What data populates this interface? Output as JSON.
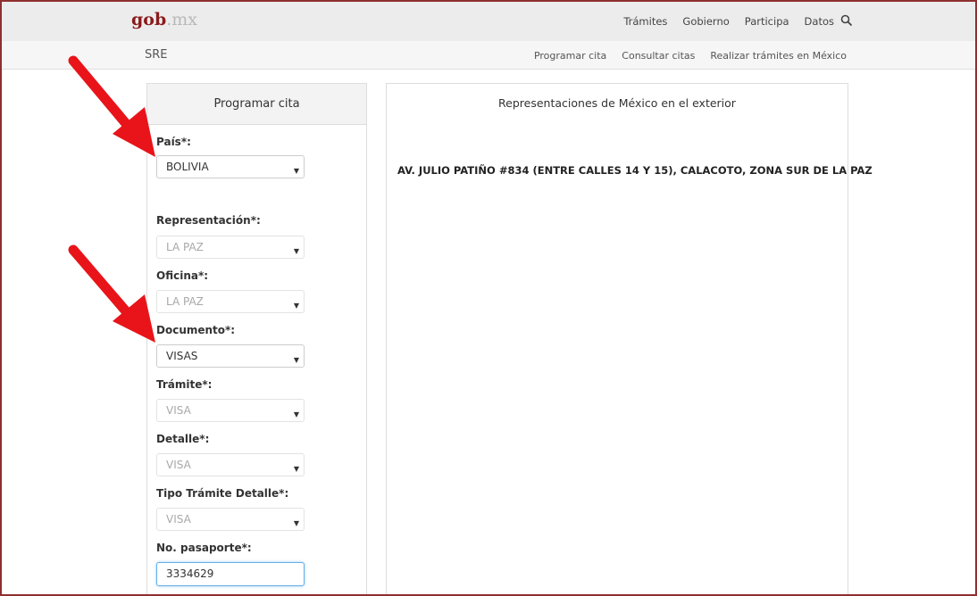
{
  "header": {
    "logo_main": "gob",
    "logo_dot": ".mx",
    "nav": [
      "Trámites",
      "Gobierno",
      "Participa",
      "Datos"
    ]
  },
  "subheader": {
    "site": "SRE",
    "nav": [
      "Programar cita",
      "Consultar citas",
      "Realizar trámites en México"
    ]
  },
  "form": {
    "title": "Programar cita",
    "fields": {
      "pais": {
        "label": "País*:",
        "value": "BOLIVIA"
      },
      "representacion": {
        "label": "Representación*:",
        "value": "LA PAZ"
      },
      "oficina": {
        "label": "Oficina*:",
        "value": "LA PAZ"
      },
      "documento": {
        "label": "Documento*:",
        "value": "VISAS"
      },
      "tramite": {
        "label": "Trámite*:",
        "value": "VISA"
      },
      "detalle": {
        "label": "Detalle*:",
        "value": "VISA"
      },
      "tipo_tramite_detalle": {
        "label": "Tipo Trámite Detalle*:",
        "value": "VISA"
      },
      "pasaporte": {
        "label": "No. pasaporte*:",
        "value": "3334629"
      }
    }
  },
  "representaciones": {
    "title": "Representaciones de México en el exterior",
    "address": "AV. JULIO PATIÑO #834 (ENTRE CALLES 14 Y 15), CALACOTO, ZONA SUR DE LA PAZ"
  },
  "colors": {
    "brand": "#8b1a1a",
    "annotation_arrow": "#e8141a"
  },
  "icons": {
    "search": "search-icon",
    "select_caret": "caret-down-icon",
    "annotation": "red-arrow-icon"
  }
}
